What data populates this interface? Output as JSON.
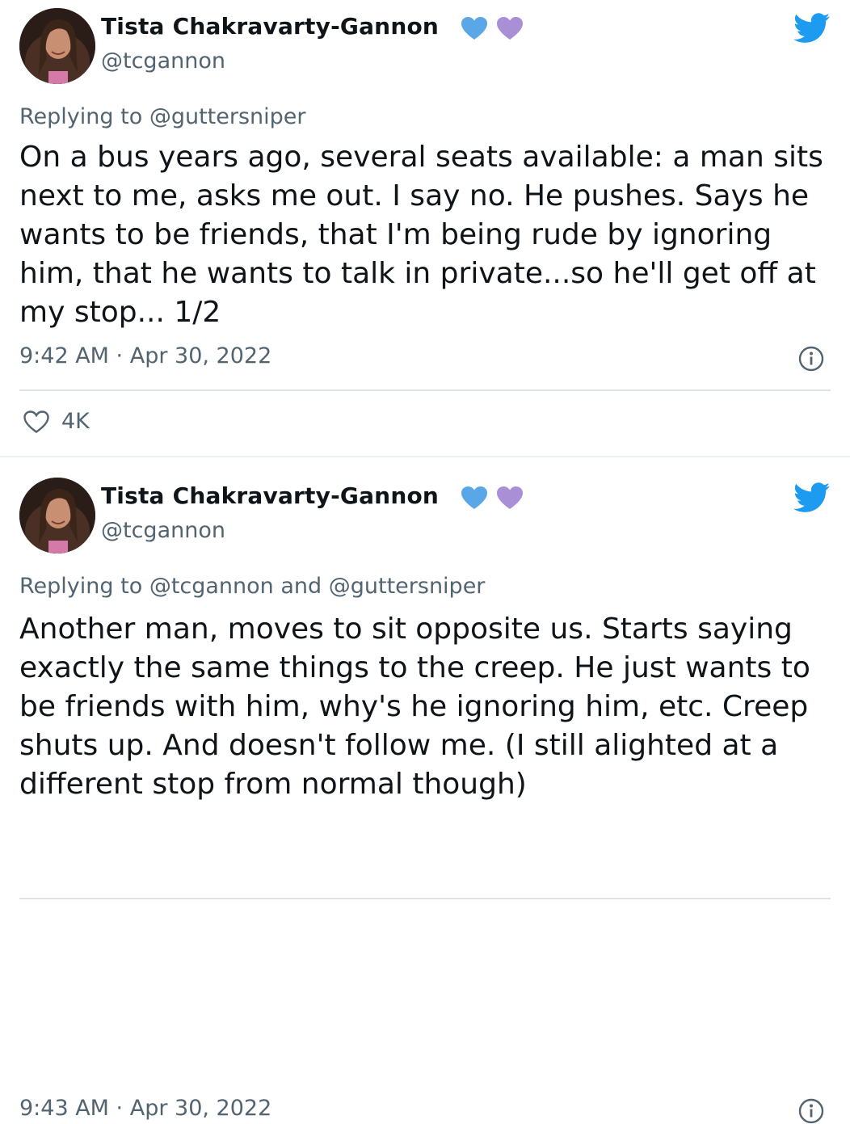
{
  "tweets": [
    {
      "author_name": "Tista Chakravarty-Gannon",
      "handle": "@tcgannon",
      "badges": [
        "blue-heart",
        "purple-heart"
      ],
      "replying_prefix": "Replying to",
      "replying_to": "@guttersniper",
      "text": "On a bus years ago, several seats available: a man sits next to me, asks me out. I say no. He pushes. Says he wants to be friends, that I'm being rude by ignoring him, that he wants to talk in private...so he'll get off at my stop... 1/2",
      "timestamp": "9:42 AM · Apr 30, 2022",
      "likes": "4K"
    },
    {
      "author_name": "Tista Chakravarty-Gannon",
      "handle": "@tcgannon",
      "badges": [
        "blue-heart",
        "purple-heart"
      ],
      "replying_prefix": "Replying to",
      "replying_to": "@tcgannon and @guttersniper",
      "text": "Another man, moves to sit opposite us. Starts saying exactly the same things to the creep. He just wants to be friends with him, why's he ignoring him, etc. Creep shuts up. And doesn't follow me. (I still alighted at a different stop from normal though)",
      "timestamp": "9:43 AM · Apr 30, 2022"
    }
  ],
  "colors": {
    "text": "#0f1419",
    "secondary": "#536471",
    "twitter_blue": "#1d9bf0",
    "blue_heart": "#5aa7e8",
    "purple_heart": "#a98fd6",
    "divider": "#dfe3e8"
  }
}
